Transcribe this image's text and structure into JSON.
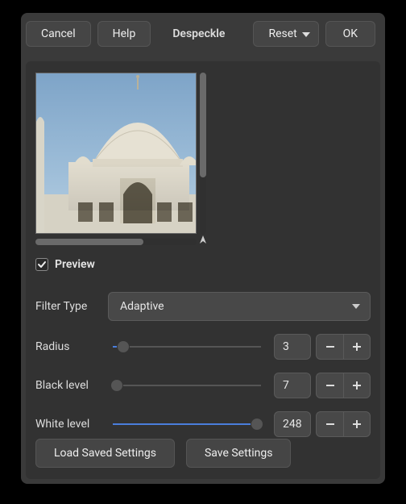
{
  "top": {
    "cancel": "Cancel",
    "help": "Help",
    "title": "Despeckle",
    "reset": "Reset",
    "ok": "OK"
  },
  "preview": {
    "checkbox_label": "Preview",
    "checked": true
  },
  "filter_type": {
    "label": "Filter Type",
    "value": "Adaptive"
  },
  "radius": {
    "label": "Radius",
    "value": "3",
    "min": 1,
    "max": 30,
    "num": 3
  },
  "black_level": {
    "label": "Black level",
    "value": "7",
    "min": 0,
    "max": 255,
    "num": 7
  },
  "white_level": {
    "label": "White level",
    "value": "248",
    "min": 0,
    "max": 255,
    "num": 248
  },
  "bottom": {
    "load": "Load Saved Settings",
    "save": "Save Settings"
  }
}
